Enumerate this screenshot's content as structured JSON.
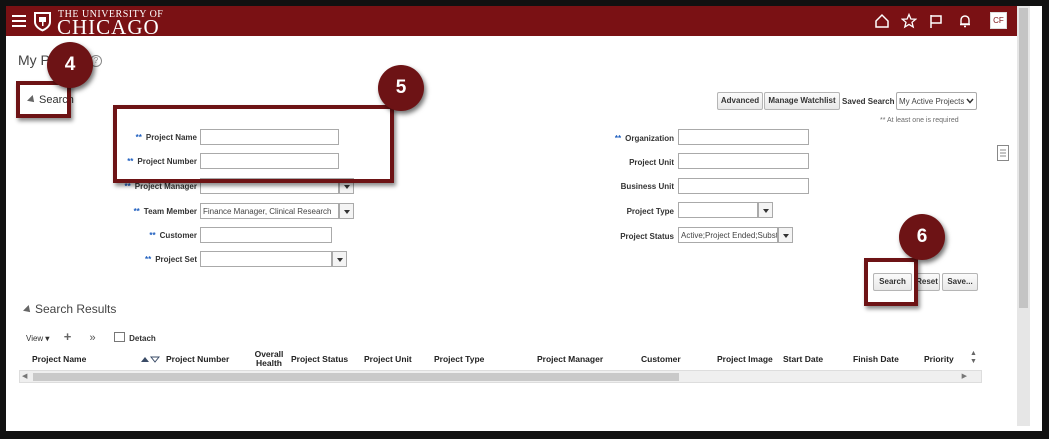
{
  "header": {
    "logo_small": "THE UNIVERSITY OF",
    "logo_big": "CHICAGO",
    "avatar_initials": "CF",
    "brand_color": "#7a1114"
  },
  "page": {
    "title_prefix": "My P",
    "title_suffix": "?"
  },
  "search": {
    "section_title": "Search",
    "advanced_label": "Advanced",
    "manage_watchlist_label": "Manage Watchlist",
    "saved_search_label": "Saved Search",
    "saved_search_value": "My Active Projects",
    "required_note": "** At least one is required",
    "required_marker": "**",
    "fields_left": [
      {
        "label": "Project Name",
        "value": ""
      },
      {
        "label": "Project Number",
        "value": ""
      },
      {
        "label": "Project Manager",
        "value": ""
      },
      {
        "label": "Team Member",
        "value": "Finance Manager, Clinical Research"
      },
      {
        "label": "Customer",
        "value": ""
      },
      {
        "label": "Project Set",
        "value": ""
      }
    ],
    "fields_right": [
      {
        "label": "Organization",
        "value": ""
      },
      {
        "label": "Project Unit",
        "value": ""
      },
      {
        "label": "Business Unit",
        "value": ""
      },
      {
        "label": "Project Type",
        "value": ""
      },
      {
        "label": "Project Status",
        "value": "Active;Project Ended;Subst"
      }
    ],
    "search_button": "Search",
    "reset_button": "Reset",
    "save_button": "Save..."
  },
  "results": {
    "section_title": "Search Results",
    "view_label": "View",
    "detach_label": "Detach",
    "columns": [
      "Project Name",
      "Project Number",
      "Overall Health",
      "Project Status",
      "Project Unit",
      "Project Type",
      "Project Manager",
      "Customer",
      "Project Image",
      "Start Date",
      "Finish Date",
      "Priority"
    ]
  },
  "markers": [
    "4",
    "5",
    "6"
  ]
}
